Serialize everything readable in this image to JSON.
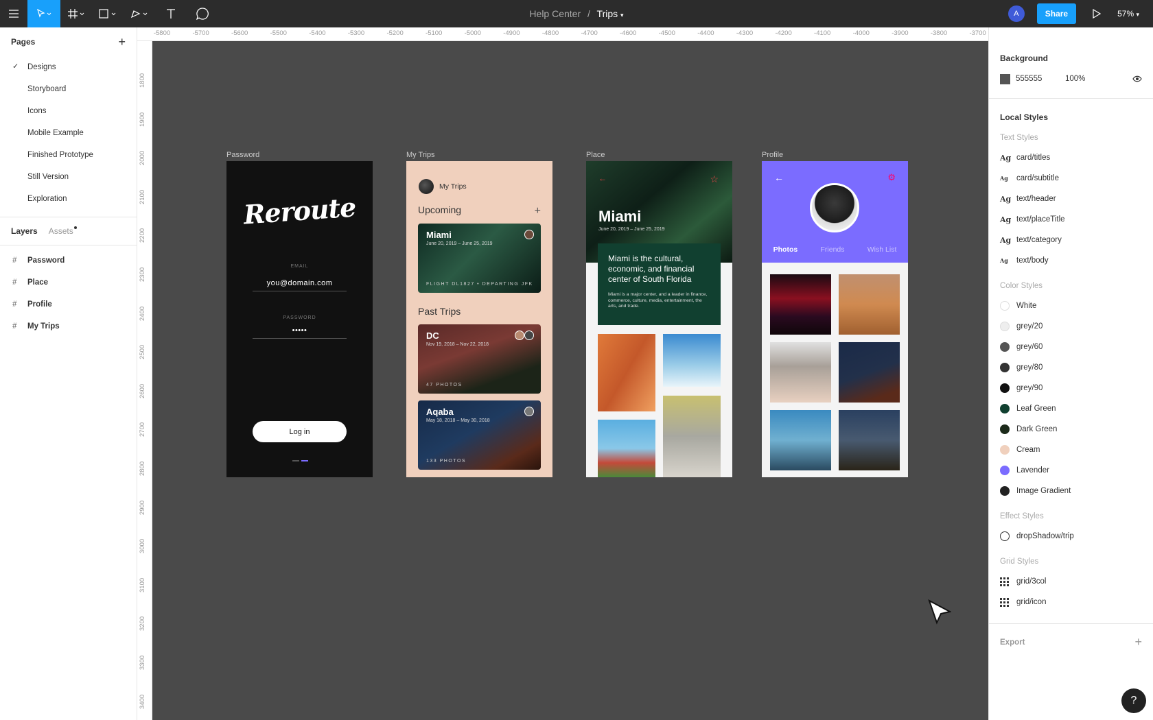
{
  "topbar": {
    "breadcrumb_parent": "Help Center",
    "separator": "/",
    "file_name": "Trips",
    "avatar_initial": "A",
    "share_label": "Share",
    "zoom": "57%"
  },
  "pages": {
    "title": "Pages",
    "items": [
      {
        "label": "Designs",
        "active": true
      },
      {
        "label": "Storyboard"
      },
      {
        "label": "Icons"
      },
      {
        "label": "Mobile Example"
      },
      {
        "label": "Finished Prototype"
      },
      {
        "label": "Still Version"
      },
      {
        "label": "Exploration"
      }
    ]
  },
  "layers": {
    "tab_layers": "Layers",
    "tab_assets": "Assets",
    "items": [
      "Password",
      "Place",
      "Profile",
      "My Trips"
    ]
  },
  "ruler": {
    "top": [
      "-5800",
      "-5700",
      "-5600",
      "-5500",
      "-5400",
      "-5300",
      "-5200",
      "-5100",
      "-5000",
      "-4900",
      "-4800",
      "-4700",
      "-4600",
      "-4500",
      "-4400",
      "-4300",
      "-4200",
      "-4100",
      "-4000",
      "-3900",
      "-3800",
      "-3700"
    ],
    "left": [
      "1800",
      "1900",
      "2000",
      "2100",
      "2200",
      "2300",
      "2400",
      "2500",
      "2600",
      "2700",
      "2800",
      "2900",
      "3000",
      "3100",
      "3200",
      "3300",
      "3400"
    ]
  },
  "frames": {
    "password": {
      "label": "Password",
      "logo": "Reroute",
      "email_label": "EMAIL",
      "email_value": "you@domain.com",
      "password_label": "PASSWORD",
      "password_value": "•••••",
      "login_label": "Log in"
    },
    "trips": {
      "label": "My Trips",
      "header": "My Trips",
      "upcoming": "Upcoming",
      "past": "Past Trips",
      "cards": [
        {
          "title": "Miami",
          "dates": "June 20, 2019 – June 25, 2019",
          "bottom": "FLIGHT DL1827 • DEPARTING JFK"
        },
        {
          "title": "DC",
          "dates": "Nov 19, 2018 – Nov 22, 2018",
          "bottom": "47 PHOTOS"
        },
        {
          "title": "Aqaba",
          "dates": "May 18, 2018 – May 30, 2018",
          "bottom": "133 PHOTOS"
        }
      ]
    },
    "place": {
      "label": "Place",
      "title": "Miami",
      "dates": "June 20, 2019 – June 25, 2019",
      "lead": "Miami is the cultural, economic, and financial center of South Florida",
      "body": "Miami is a major center, and a leader in finance, commerce, culture, media, entertainment, the arts, and trade."
    },
    "profile": {
      "label": "Profile",
      "tabs": [
        "Photos",
        "Friends",
        "Wish List"
      ]
    }
  },
  "right_panel": {
    "background_title": "Background",
    "background_hex": "555555",
    "background_opacity": "100%",
    "local_styles_title": "Local Styles",
    "text_styles_title": "Text Styles",
    "text_styles": [
      "card/titles",
      "card/subtitle",
      "text/header",
      "text/placeTitle",
      "text/category",
      "text/body"
    ],
    "color_styles_title": "Color Styles",
    "color_styles": [
      {
        "name": "White",
        "color": "#ffffff"
      },
      {
        "name": "grey/20",
        "color": "#eeeeee"
      },
      {
        "name": "grey/60",
        "color": "#555555"
      },
      {
        "name": "grey/80",
        "color": "#333333"
      },
      {
        "name": "grey/90",
        "color": "#111111"
      },
      {
        "name": "Leaf Green",
        "color": "#114030"
      },
      {
        "name": "Dark Green",
        "color": "#1c2a1a"
      },
      {
        "name": "Cream",
        "color": "#f0d0bd"
      },
      {
        "name": "Lavender",
        "color": "#7b6cff"
      },
      {
        "name": "Image Gradient",
        "color": "#222222"
      }
    ],
    "effect_styles_title": "Effect Styles",
    "effect_styles": [
      "dropShadow/trip"
    ],
    "grid_styles_title": "Grid Styles",
    "grid_styles": [
      "grid/3col",
      "grid/icon"
    ],
    "export_title": "Export",
    "help_label": "?"
  }
}
